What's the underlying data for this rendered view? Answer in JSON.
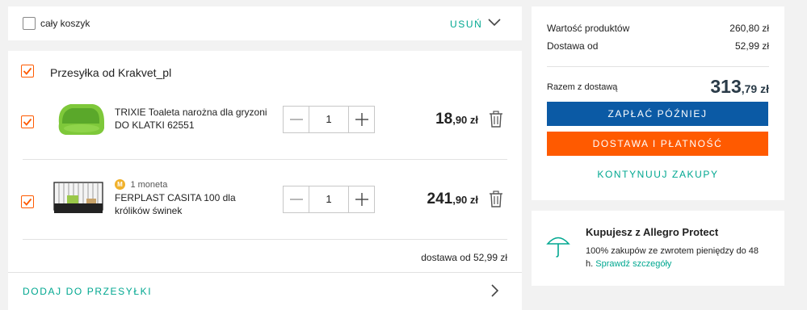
{
  "top_bar": {
    "select_all_label": "cały koszyk",
    "remove_label": "USUŃ"
  },
  "seller": {
    "title": "Przesyłka od Krakvet_pl",
    "items": [
      {
        "name": "TRIXIE Toaleta narożna dla gryzoni DO KLATKI 62551",
        "quantity": "1",
        "price_main": "18",
        "price_cents": ",90 zł"
      },
      {
        "coin_label": "1 moneta",
        "coin_badge": "M",
        "name": "FERPLAST CASITA 100 dla królików świnek",
        "quantity": "1",
        "price_main": "241",
        "price_cents": ",90 zł"
      }
    ],
    "shipping_note": "dostawa od 52,99 zł",
    "add_to_shipment_label": "DODAJ DO PRZESYŁKI"
  },
  "summary": {
    "products_label": "Wartość produktów",
    "products_value": "260,80 zł",
    "delivery_label": "Dostawa od",
    "delivery_value": "52,99 zł",
    "total_label": "Razem z dostawą",
    "total_main": "313",
    "total_cents": ",79 zł",
    "pay_later_label": "ZAPŁAĆ PÓŹNIEJ",
    "checkout_label": "DOSTAWA I PŁATNOŚĆ",
    "continue_label": "KONTYNUUJ ZAKUPY"
  },
  "protect": {
    "title": "Kupujesz z Allegro Protect",
    "text": "100% zakupów ze zwrotem pieniędzy do 48 h.",
    "link": "Sprawdź szczegóły"
  },
  "colors": {
    "accent_orange": "#ff5a00",
    "primary_blue": "#0b5aa5",
    "teal": "#00a790"
  },
  "icons": [
    "checkbox-icon",
    "chevron-down-icon",
    "minus-icon",
    "plus-icon",
    "trash-icon",
    "chevron-right-icon",
    "umbrella-icon",
    "coin-icon"
  ]
}
